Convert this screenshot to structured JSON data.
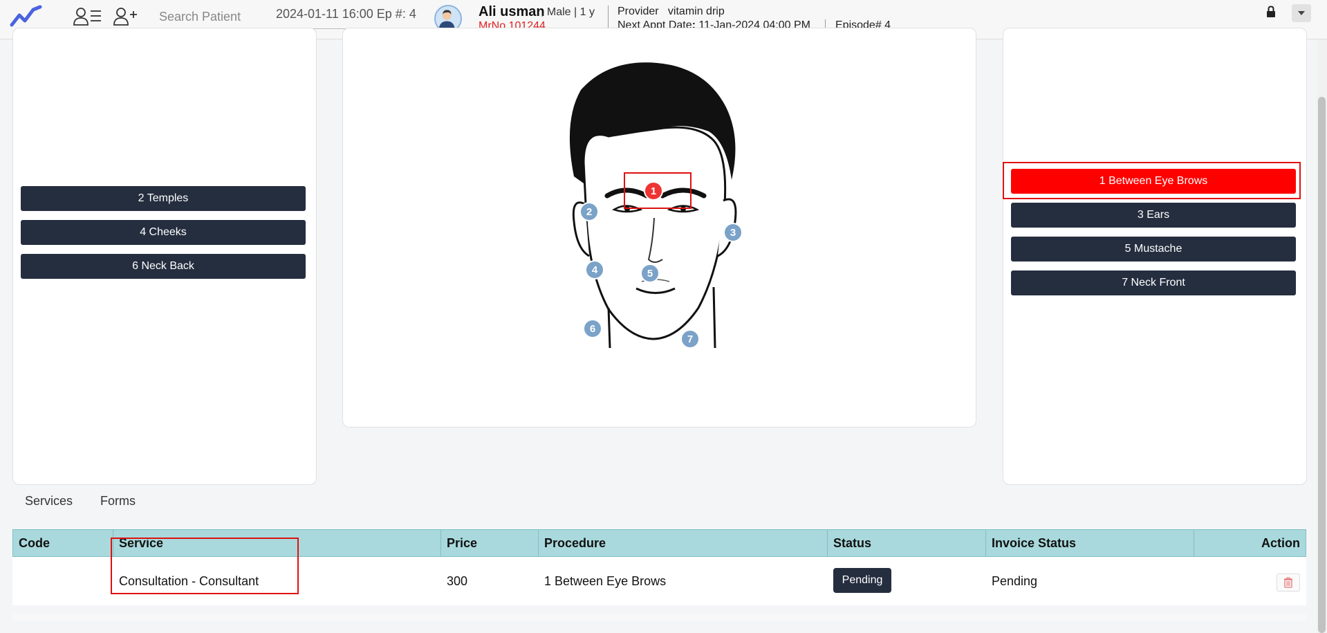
{
  "header": {
    "search_placeholder": "Search Patient",
    "episode_select": "2024-01-11 16:00 Ep #: 4",
    "patient_name": "Ali usman",
    "patient_meta": ", Male | 1 y",
    "mrn": "MrNo 101244",
    "provider_label": "Provider",
    "provider_value": "vitamin drip",
    "appt_label": "Next Appt Date",
    "appt_value": "11-Jan-2024 04:00 PM",
    "episode": "Episode# 4"
  },
  "left_zones": [
    {
      "label": "2 Temples"
    },
    {
      "label": "4 Cheeks"
    },
    {
      "label": "6 Neck Back"
    }
  ],
  "right_zones": [
    {
      "label": "1 Between Eye Brows",
      "active": true
    },
    {
      "label": "3 Ears"
    },
    {
      "label": "5 Mustache"
    },
    {
      "label": "7 Neck Front"
    }
  ],
  "markers": [
    "1",
    "2",
    "3",
    "4",
    "5",
    "6",
    "7"
  ],
  "tabs": [
    "Services",
    "Forms"
  ],
  "table": {
    "headers": [
      "Code",
      "Service",
      "Price",
      "Procedure",
      "Status",
      "Invoice Status",
      "Action"
    ],
    "rows": [
      {
        "code": "",
        "service": "Consultation - Consultant",
        "price": "300",
        "procedure": "1 Between Eye Brows",
        "status": "Pending",
        "invoice_status": "Pending"
      }
    ]
  },
  "colors": {
    "dark_button": "#252e3f",
    "active_zone": "#ff0000",
    "marker": "#7ba2c8",
    "table_header": "#a9d9dc",
    "highlight": "#e01010"
  }
}
